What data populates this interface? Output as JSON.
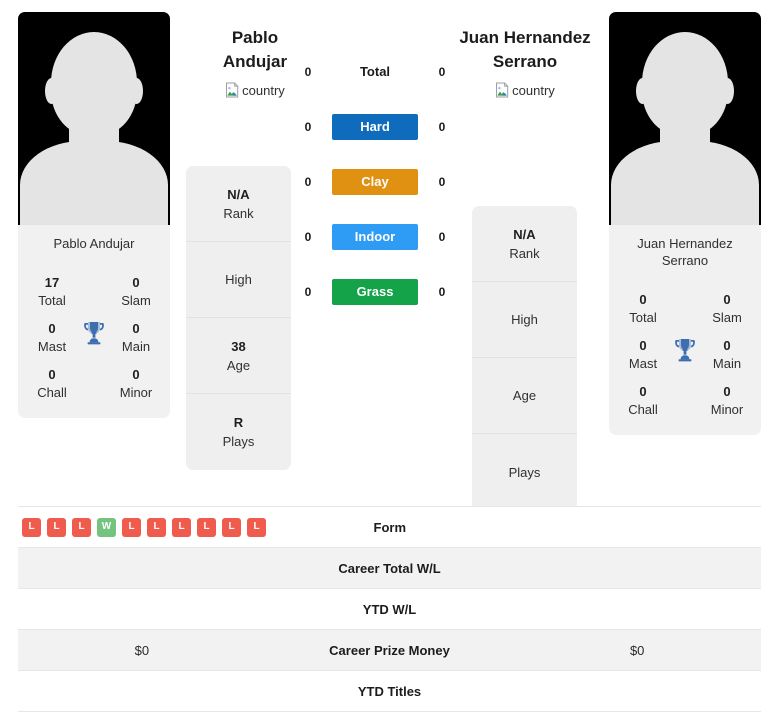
{
  "players": {
    "left": {
      "full_name": "Pablo Andujar",
      "name_line1": "Pablo",
      "name_line2": "Andujar",
      "card_name": "Pablo Andujar",
      "country_alt": "country",
      "titles": {
        "total_value": "17",
        "total_label": "Total",
        "slam_value": "0",
        "slam_label": "Slam",
        "mast_value": "0",
        "mast_label": "Mast",
        "main_value": "0",
        "main_label": "Main",
        "chall_value": "0",
        "chall_label": "Chall",
        "minor_value": "0",
        "minor_label": "Minor"
      },
      "info": {
        "rank_value": "N/A",
        "rank_label": "Rank",
        "high_value": "",
        "high_label": "High",
        "age_value": "38",
        "age_label": "Age",
        "plays_value": "R",
        "plays_label": "Plays"
      }
    },
    "right": {
      "full_name": "Juan Hernandez Serrano",
      "name_line1": "Juan Hernandez",
      "name_line2": "Serrano",
      "card_name_line1": "Juan Hernandez",
      "card_name_line2": "Serrano",
      "country_alt": "country",
      "titles": {
        "total_value": "0",
        "total_label": "Total",
        "slam_value": "0",
        "slam_label": "Slam",
        "mast_value": "0",
        "mast_label": "Mast",
        "main_value": "0",
        "main_label": "Main",
        "chall_value": "0",
        "chall_label": "Chall",
        "minor_value": "0",
        "minor_label": "Minor"
      },
      "info": {
        "rank_value": "N/A",
        "rank_label": "Rank",
        "high_value": "",
        "high_label": "High",
        "age_value": "",
        "age_label": "Age",
        "plays_value": "",
        "plays_label": "Plays"
      }
    }
  },
  "surfaces": [
    {
      "key": "total",
      "label": "Total",
      "left_value": "0",
      "right_value": "0",
      "color": "transparent",
      "plain": true
    },
    {
      "key": "hard",
      "label": "Hard",
      "left_value": "0",
      "right_value": "0",
      "color": "#0f6cbd",
      "plain": false
    },
    {
      "key": "clay",
      "label": "Clay",
      "left_value": "0",
      "right_value": "0",
      "color": "#e09112",
      "plain": false
    },
    {
      "key": "indoor",
      "label": "Indoor",
      "left_value": "0",
      "right_value": "0",
      "color": "#2e9bf5",
      "plain": false
    },
    {
      "key": "grass",
      "label": "Grass",
      "left_value": "0",
      "right_value": "0",
      "color": "#15a349",
      "plain": false
    }
  ],
  "form": {
    "label": "Form",
    "left_badges": [
      {
        "result": "L"
      },
      {
        "result": "L"
      },
      {
        "result": "L"
      },
      {
        "result": "W"
      },
      {
        "result": "L"
      },
      {
        "result": "L"
      },
      {
        "result": "L"
      },
      {
        "result": "L"
      },
      {
        "result": "L"
      },
      {
        "result": "L"
      }
    ],
    "right_badges": [],
    "win_color": "#74c37f",
    "loss_color": "#ef5b4c"
  },
  "stat_rows": [
    {
      "label": "Career Total W/L",
      "left_value": "",
      "right_value": "",
      "shaded": true
    },
    {
      "label": "YTD W/L",
      "left_value": "",
      "right_value": "",
      "shaded": false
    },
    {
      "label": "Career Prize Money",
      "left_value": "$0",
      "right_value": "$0",
      "shaded": true
    },
    {
      "label": "YTD Titles",
      "left_value": "",
      "right_value": "",
      "shaded": false
    }
  ]
}
